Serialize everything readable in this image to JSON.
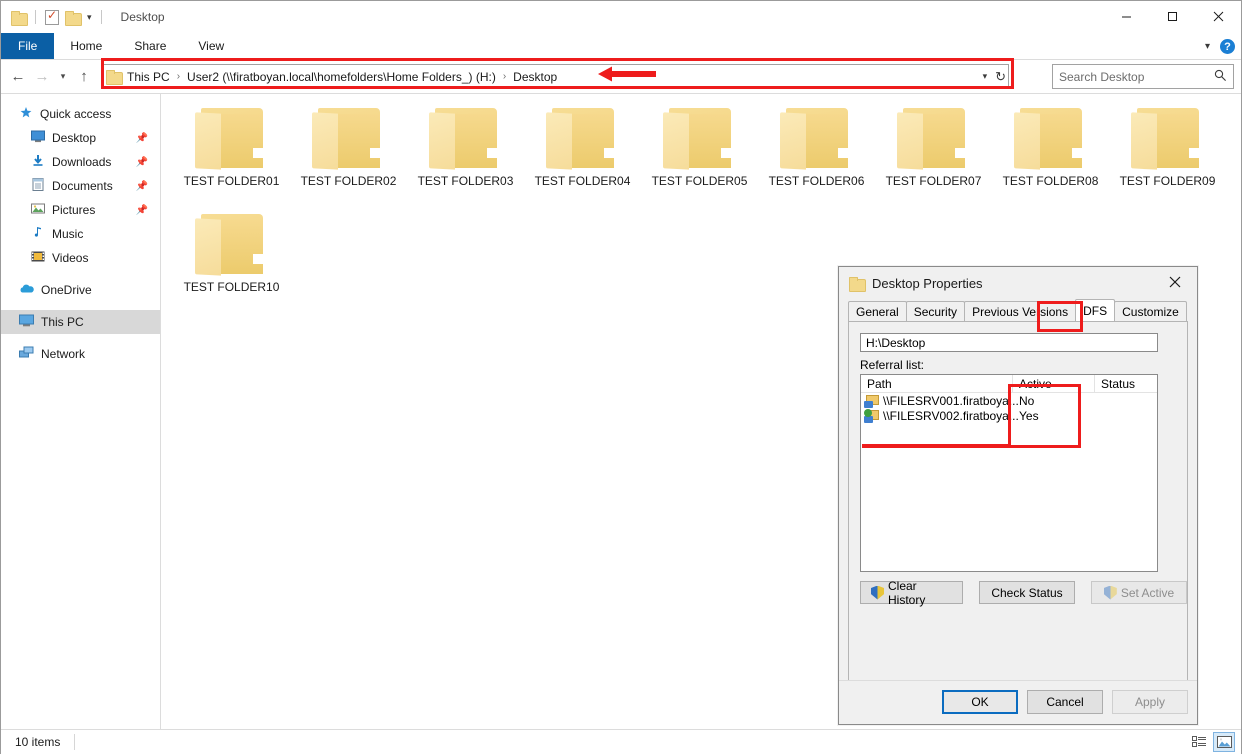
{
  "window": {
    "title": "Desktop",
    "quick_access_icons": [
      "folder-icon",
      "properties-icon",
      "new-folder-icon",
      "dropdown-caret-icon"
    ],
    "controls": {
      "minimize": "minimize-icon",
      "maximize": "maximize-icon",
      "close": "close-icon"
    }
  },
  "ribbon": {
    "tabs": [
      {
        "label": "File"
      },
      {
        "label": "Home"
      },
      {
        "label": "Share"
      },
      {
        "label": "View"
      }
    ],
    "collapse_icon": "chevron-down-icon",
    "help_icon": "help-icon",
    "help_label": "?"
  },
  "addressbar": {
    "back_icon": "back-arrow-icon",
    "forward_icon": "forward-arrow-icon",
    "recent_icon": "recent-locations-icon",
    "up_icon": "up-arrow-icon",
    "crumbs": [
      "This PC",
      "User2 (\\\\firatboyan.local\\homefolders\\Home Folders_) (H:)",
      "Desktop"
    ],
    "separator": "›",
    "dropdown_icon": "chevron-down-icon",
    "refresh_icon": "refresh-icon"
  },
  "search": {
    "placeholder": "Search Desktop",
    "icon": "search-icon"
  },
  "navpane": {
    "groups": [
      {
        "header": {
          "label": "Quick access",
          "icon": "star-pin-icon"
        },
        "items": [
          {
            "label": "Desktop",
            "icon": "desktop-icon",
            "pinned": true
          },
          {
            "label": "Downloads",
            "icon": "downloads-icon",
            "pinned": true
          },
          {
            "label": "Documents",
            "icon": "documents-icon",
            "pinned": true
          },
          {
            "label": "Pictures",
            "icon": "pictures-icon",
            "pinned": true
          },
          {
            "label": "Music",
            "icon": "music-icon",
            "pinned": false
          },
          {
            "label": "Videos",
            "icon": "videos-icon",
            "pinned": false
          }
        ]
      },
      {
        "header": {
          "label": "OneDrive",
          "icon": "onedrive-icon"
        },
        "items": []
      },
      {
        "header": {
          "label": "This PC",
          "icon": "this-pc-icon",
          "selected": true
        },
        "items": []
      },
      {
        "header": {
          "label": "Network",
          "icon": "network-icon"
        },
        "items": []
      }
    ],
    "pin_glyph": "📌"
  },
  "files": [
    {
      "name": "TEST FOLDER01"
    },
    {
      "name": "TEST FOLDER02"
    },
    {
      "name": "TEST FOLDER03"
    },
    {
      "name": "TEST FOLDER04"
    },
    {
      "name": "TEST FOLDER05"
    },
    {
      "name": "TEST FOLDER06"
    },
    {
      "name": "TEST FOLDER07"
    },
    {
      "name": "TEST FOLDER08"
    },
    {
      "name": "TEST FOLDER09"
    },
    {
      "name": "TEST FOLDER10"
    }
  ],
  "statusbar": {
    "item_count": "10 items",
    "views": [
      {
        "name": "details-view",
        "active": false
      },
      {
        "name": "large-icons-view",
        "active": true
      }
    ]
  },
  "dialog": {
    "title": "Desktop Properties",
    "icon": "folder-icon",
    "close_icon": "close-icon",
    "tabs": [
      {
        "label": "General",
        "active": false
      },
      {
        "label": "Security",
        "active": false
      },
      {
        "label": "Previous Versions",
        "active": false
      },
      {
        "label": "DFS",
        "active": true
      },
      {
        "label": "Customize",
        "active": false
      }
    ],
    "path_value": "H:\\Desktop",
    "referral_label": "Referral list:",
    "columns": [
      "Path",
      "Active",
      "Status"
    ],
    "rows": [
      {
        "path": "\\\\FILESRV001.firatboya...",
        "active": "No",
        "status": "",
        "icon": "shared-folder-icon"
      },
      {
        "path": "\\\\FILESRV002.firatboya...",
        "active": "Yes",
        "status": "",
        "icon": "shared-folder-active-icon"
      }
    ],
    "buttons": [
      {
        "label": "Clear History",
        "shield": true,
        "disabled": false
      },
      {
        "label": "Check Status",
        "shield": false,
        "disabled": false
      },
      {
        "label": "Set Active",
        "shield": true,
        "disabled": true
      }
    ],
    "footer_buttons": [
      {
        "label": "OK",
        "default": true,
        "disabled": false
      },
      {
        "label": "Cancel",
        "default": false,
        "disabled": false
      },
      {
        "label": "Apply",
        "default": false,
        "disabled": true
      }
    ]
  },
  "annotations": {
    "address_highlight": "red-rectangle-address-bar",
    "address_arrow": "red-arrow-pointing-to-desktop",
    "dfs_tab_highlight": "red-rectangle-dfs-tab",
    "active_column_highlight": "red-rectangle-active-column",
    "color": "#ee1c1c"
  }
}
